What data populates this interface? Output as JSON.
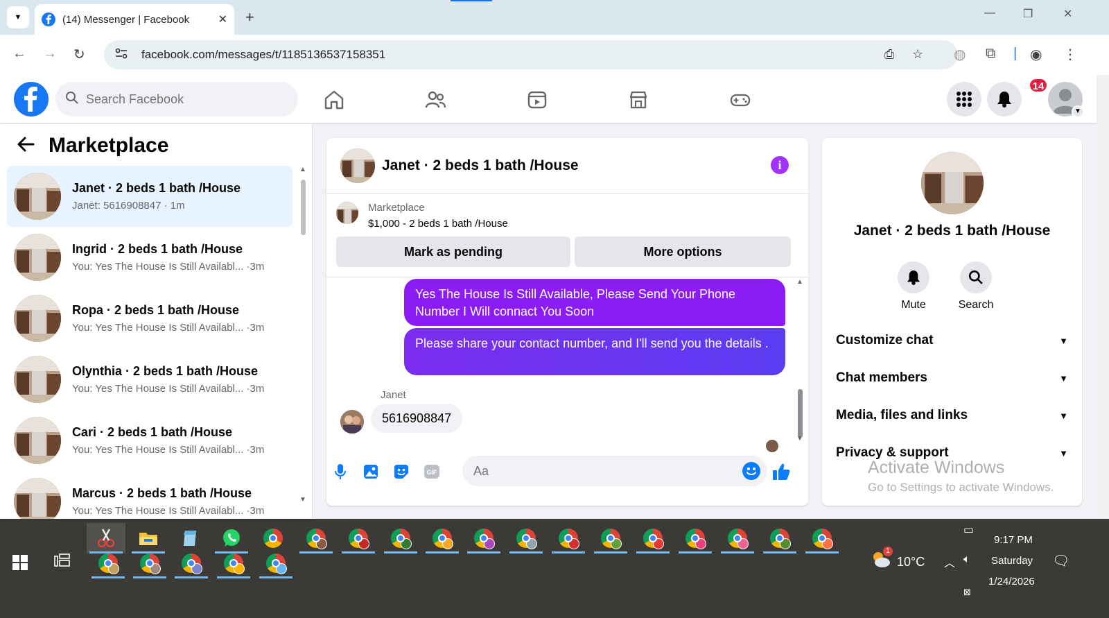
{
  "browser": {
    "tab_title": "(14) Messenger | Facebook",
    "url": "facebook.com/messages/t/1185136537158351"
  },
  "fb": {
    "search_placeholder": "Search Facebook",
    "notification_count": "14"
  },
  "left": {
    "title": "Marketplace",
    "conversations": [
      {
        "name": "Janet · 2 beds 1 bath /House",
        "preview": "Janet: 5616908847 · 1m",
        "active": true
      },
      {
        "name": "Ingrid · 2 beds 1 bath /House",
        "preview": "You: Yes The House Is Still Availabl... ·3m"
      },
      {
        "name": "Ropa · 2 beds 1 bath /House",
        "preview": "You: Yes The House Is Still Availabl... ·3m"
      },
      {
        "name": "Olynthia · 2 beds 1 bath /House",
        "preview": "You: Yes The House Is Still Availabl... ·3m"
      },
      {
        "name": "Cari · 2 beds 1 bath /House",
        "preview": "You: Yes The House Is Still Availabl... ·3m"
      },
      {
        "name": "Marcus · 2 beds 1 bath /House",
        "preview": "You: Yes The House Is Still Availabl... ·3m"
      }
    ]
  },
  "chat": {
    "title": "Janet · 2 beds 1 bath /House",
    "marketplace_label": "Marketplace",
    "listing": "$1,000 - 2 beds 1 bath /House",
    "mark_pending": "Mark as pending",
    "more_options": "More options",
    "messages_out": [
      "Yes The House Is Still Available, Please Send Your Phone Number I Will connact You Soon",
      "Please share your contact number, and I'll send you the details ."
    ],
    "sender": "Janet",
    "message_in": "5616908847",
    "composer_placeholder": "Aa"
  },
  "right": {
    "name": "Janet · 2 beds 1 bath /House",
    "mute": "Mute",
    "search": "Search",
    "sections": [
      "Customize chat",
      "Chat members",
      "Media, files and links",
      "Privacy & support"
    ]
  },
  "watermark": {
    "line1": "Activate Windows",
    "line2": "Go to Settings to activate Windows."
  },
  "tray": {
    "temp": "10°C",
    "time": "9:17 PM",
    "day": "Saturday",
    "date": "1/24/2026",
    "weather_badge": "1"
  },
  "colors": {
    "fb_blue": "#1877f2",
    "bubble_purple": "#8b1cf5",
    "bubble_indigo": "#5b3df2",
    "badge_red": "#e41e3f"
  }
}
